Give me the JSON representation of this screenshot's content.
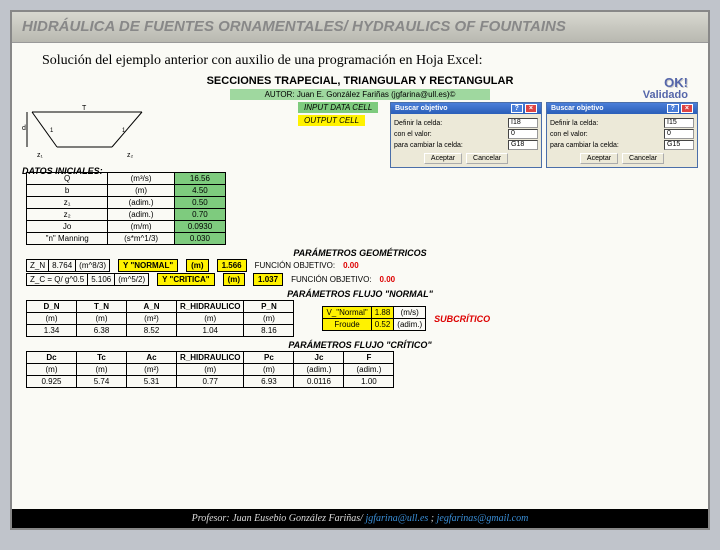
{
  "banner": "HIDRÁULICA DE FUENTES ORNAMENTALES/ HYDRAULICS OF FOUNTAINS",
  "intro": "Solución del ejemplo anterior con auxilio de una programación en Hoja Excel:",
  "worksheet_title": "SECCIONES TRAPECIAL, TRIANGULAR Y RECTANGULAR",
  "author_line": "AUTOR: Juan E. González Fariñas (jgfarina@ull.es)©",
  "legend_input": "INPUT DATA CELL",
  "legend_output": "OUTPUT CELL",
  "ok": "OK!",
  "validated": "Validado",
  "datos_title": "DATOS INICIALES:",
  "datos": [
    {
      "sym": "Q",
      "unit": "(m³/s)",
      "val": "16.56"
    },
    {
      "sym": "b",
      "unit": "(m)",
      "val": "4.50"
    },
    {
      "sym": "z₁",
      "unit": "(adim.)",
      "val": "0.50"
    },
    {
      "sym": "z₂",
      "unit": "(adim.)",
      "val": "0.70"
    },
    {
      "sym": "Jo",
      "unit": "(m/m)",
      "val": "0.0930"
    },
    {
      "sym": "\"n\" Manning",
      "unit": "(s*m^1/3)",
      "val": "0.030"
    }
  ],
  "sketch_labels": {
    "z1": "z₁",
    "z2": "z₂",
    "t": "T",
    "d": "d",
    "one_l": "1",
    "one_r": "1"
  },
  "dialog": {
    "title": "Buscar objetivo",
    "row1": "Definir la celda:",
    "row2": "con el valor:",
    "row3": "para cambiar la celda:",
    "btn_ok": "Aceptar",
    "btn_cancel": "Cancelar"
  },
  "dlg1": {
    "def": "I18",
    "val": "0",
    "chg": "G18"
  },
  "dlg2": {
    "def": "I15",
    "val": "0",
    "chg": "G15"
  },
  "params_geo": "PARÁMETROS GEOMÉTRICOS",
  "zn": {
    "label": "Z_N",
    "val": "8.764",
    "unit": "(m^8/3)"
  },
  "zc": {
    "label": "Z_C = Q/ g^0.5",
    "val": "5.106",
    "unit": "(m^5/2)"
  },
  "y_normal": {
    "lbl": "Y \"NORMAL\"",
    "unit": "(m)",
    "val": "1.566"
  },
  "y_critico": {
    "lbl": "Y \"CRITICA\"",
    "unit": "(m)",
    "val": "1.037"
  },
  "fn_obj": "FUNCIÓN OBJETIVO:",
  "fn_val": "0.00",
  "params_normal": "PARÁMETROS FLUJO \"NORMAL\"",
  "normal_headers": [
    "D_N",
    "T_N",
    "A_N",
    "R_HIDRAULICO",
    "P_N"
  ],
  "normal_units": [
    "(m)",
    "(m)",
    "(m²)",
    "(m)",
    "(m)"
  ],
  "normal_vals": [
    "1.34",
    "6.38",
    "8.52",
    "1.04",
    "8.16"
  ],
  "v_normal": {
    "lbl": "V_\"Normal\"",
    "val": "1.88",
    "unit": "(m/s)"
  },
  "froude": {
    "lbl": "Froude",
    "val": "0.52",
    "unit": "(adim.)"
  },
  "subcritico": "SUBCRÍTICO",
  "params_critico": "PARÁMETROS FLUJO \"CRÍTICO\"",
  "crit_headers": [
    "Dc",
    "Tc",
    "Ac",
    "R_HIDRAULICO",
    "Pc",
    "Jc",
    "F"
  ],
  "crit_units": [
    "(m)",
    "(m)",
    "(m²)",
    "(m)",
    "(m)",
    "(adim.)",
    "(adim.)"
  ],
  "crit_vals": [
    "0.925",
    "5.74",
    "5.31",
    "0.77",
    "6.93",
    "0.0116",
    "1.00"
  ],
  "footer": {
    "label": "Profesor: Juan Eusebio González Fariñas/ ",
    "email1": "jgfarina@ull.es",
    "sep": "; ",
    "email2": "jegfarinas@gmail.com"
  }
}
